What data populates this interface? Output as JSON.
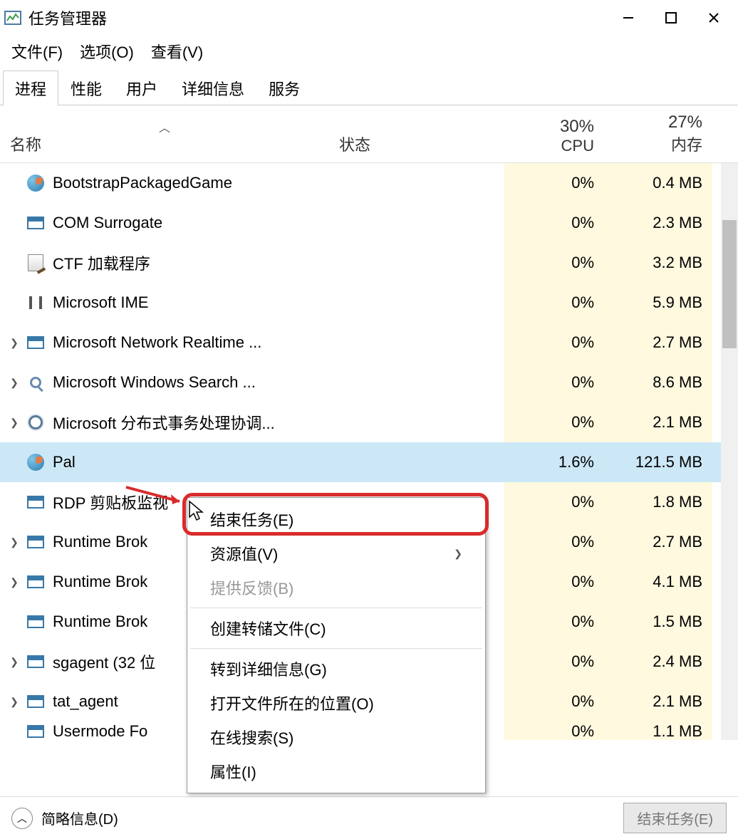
{
  "window": {
    "title": "任务管理器"
  },
  "menu": {
    "file": "文件(F)",
    "options": "选项(O)",
    "view": "查看(V)"
  },
  "tabs": [
    {
      "label": "进程",
      "active": true
    },
    {
      "label": "性能",
      "active": false
    },
    {
      "label": "用户",
      "active": false
    },
    {
      "label": "详细信息",
      "active": false
    },
    {
      "label": "服务",
      "active": false
    }
  ],
  "columns": {
    "name": "名称",
    "status": "状态",
    "cpu_pct": "30%",
    "cpu_label": "CPU",
    "mem_pct": "27%",
    "mem_label": "内存"
  },
  "processes": [
    {
      "name": "BootstrapPackagedGame",
      "cpu": "0%",
      "mem": "0.4 MB",
      "expandable": false,
      "icon": "globe",
      "selected": false
    },
    {
      "name": "COM Surrogate",
      "cpu": "0%",
      "mem": "2.3 MB",
      "expandable": false,
      "icon": "win",
      "selected": false
    },
    {
      "name": "CTF 加载程序",
      "cpu": "0%",
      "mem": "3.2 MB",
      "expandable": false,
      "icon": "notepad",
      "selected": false
    },
    {
      "name": "Microsoft IME",
      "cpu": "0%",
      "mem": "5.9 MB",
      "expandable": false,
      "icon": "ime",
      "selected": false
    },
    {
      "name": "Microsoft Network Realtime ...",
      "cpu": "0%",
      "mem": "2.7 MB",
      "expandable": true,
      "icon": "win",
      "selected": false
    },
    {
      "name": "Microsoft Windows Search ...",
      "cpu": "0%",
      "mem": "8.6 MB",
      "expandable": true,
      "icon": "search",
      "selected": false
    },
    {
      "name": "Microsoft 分布式事务处理协调...",
      "cpu": "0%",
      "mem": "2.1 MB",
      "expandable": true,
      "icon": "cog",
      "selected": false
    },
    {
      "name": "Pal",
      "cpu": "1.6%",
      "mem": "121.5 MB",
      "expandable": false,
      "icon": "globe",
      "selected": true
    },
    {
      "name": "RDP 剪贴板监视",
      "cpu": "0%",
      "mem": "1.8 MB",
      "expandable": false,
      "icon": "win",
      "selected": false,
      "cut": true
    },
    {
      "name": "Runtime Brok",
      "cpu": "0%",
      "mem": "2.7 MB",
      "expandable": true,
      "icon": "win",
      "selected": false,
      "cut": true
    },
    {
      "name": "Runtime Brok",
      "cpu": "0%",
      "mem": "4.1 MB",
      "expandable": true,
      "icon": "win",
      "selected": false,
      "cut": true
    },
    {
      "name": "Runtime Brok",
      "cpu": "0%",
      "mem": "1.5 MB",
      "expandable": false,
      "icon": "win",
      "selected": false,
      "cut": true
    },
    {
      "name": "sgagent (32 位",
      "cpu": "0%",
      "mem": "2.4 MB",
      "expandable": true,
      "icon": "win",
      "selected": false,
      "cut": true
    },
    {
      "name": "tat_agent",
      "cpu": "0%",
      "mem": "2.1 MB",
      "expandable": true,
      "icon": "win",
      "selected": false,
      "cut": true
    },
    {
      "name": "Usermode Fo",
      "cpu": "0%",
      "mem": "1.1 MB",
      "expandable": false,
      "icon": "win",
      "selected": false,
      "cut": true,
      "partial": true
    }
  ],
  "context_menu": [
    {
      "label": "结束任务(E)",
      "type": "item"
    },
    {
      "label": "资源值(V)",
      "type": "submenu"
    },
    {
      "label": "提供反馈(B)",
      "type": "disabled"
    },
    {
      "type": "sep"
    },
    {
      "label": "创建转储文件(C)",
      "type": "item"
    },
    {
      "type": "sep"
    },
    {
      "label": "转到详细信息(G)",
      "type": "item"
    },
    {
      "label": "打开文件所在的位置(O)",
      "type": "item"
    },
    {
      "label": "在线搜索(S)",
      "type": "item"
    },
    {
      "label": "属性(I)",
      "type": "item"
    }
  ],
  "footer": {
    "fewer": "简略信息(D)",
    "end_task": "结束任务(E)"
  }
}
